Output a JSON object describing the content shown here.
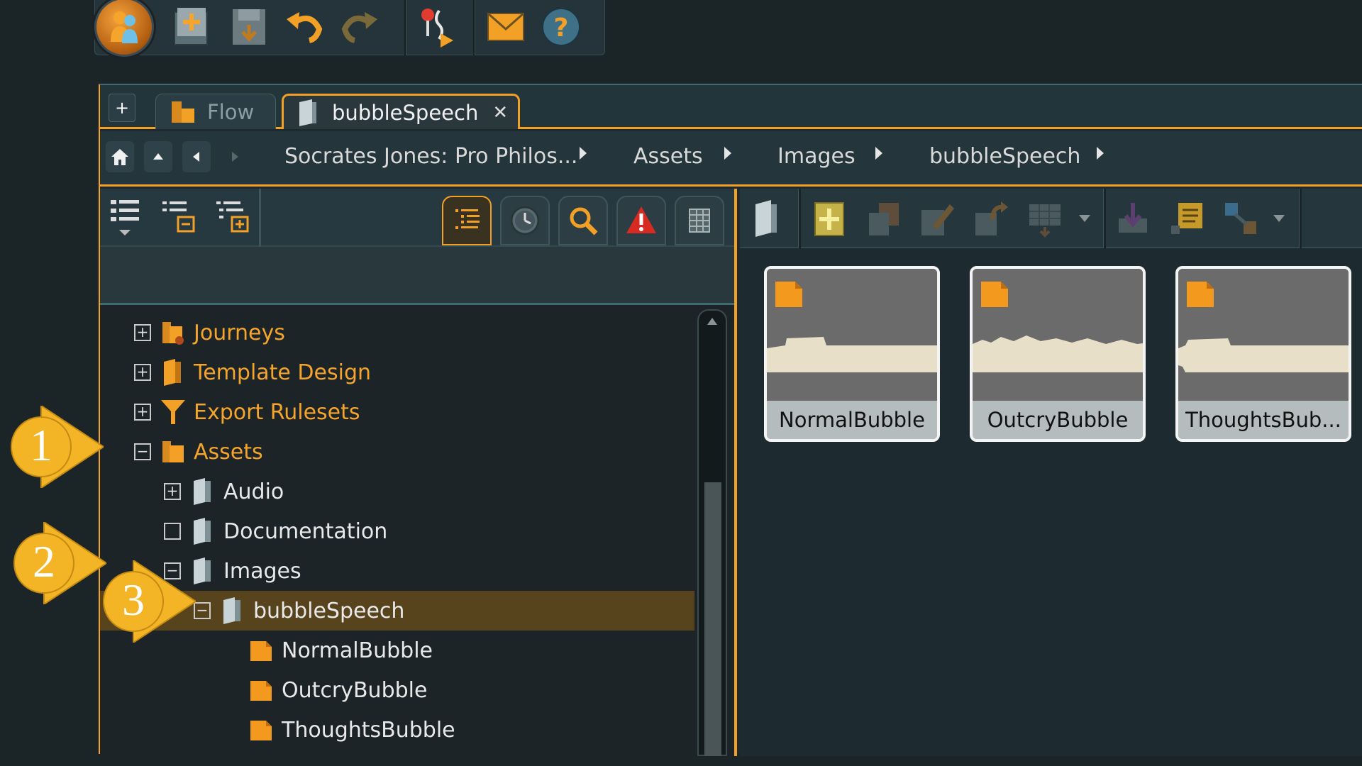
{
  "toolbar": {
    "buttons": [
      {
        "name": "user-icon"
      },
      {
        "name": "new-project-icon"
      },
      {
        "name": "save-icon"
      },
      {
        "name": "undo-icon"
      },
      {
        "name": "redo-icon"
      },
      {
        "name": "debug-run-icon"
      },
      {
        "name": "mail-icon"
      },
      {
        "name": "help-icon"
      }
    ]
  },
  "tabs": {
    "add_label": "+",
    "items": [
      {
        "label": "Flow",
        "active": false
      },
      {
        "label": "bubbleSpeech",
        "active": true,
        "close": "✕"
      }
    ]
  },
  "breadcrumb": {
    "items": [
      "Socrates Jones: Pro Philos...",
      "Assets",
      "Images",
      "bubbleSpeech"
    ]
  },
  "tree": {
    "nodes": [
      {
        "label": "Journeys",
        "expander": "+",
        "color": "orange"
      },
      {
        "label": "Template Design",
        "expander": "+",
        "color": "orange"
      },
      {
        "label": "Export Rulesets",
        "expander": "+",
        "color": "orange"
      },
      {
        "label": "Assets",
        "expander": "−",
        "color": "orange"
      },
      {
        "label": "Audio",
        "expander": "+",
        "color": "white"
      },
      {
        "label": "Documentation",
        "expander": "",
        "color": "white"
      },
      {
        "label": "Images",
        "expander": "−",
        "color": "white"
      },
      {
        "label": "bubbleSpeech",
        "expander": "−",
        "color": "white",
        "selected": true
      },
      {
        "label": "NormalBubble",
        "color": "white"
      },
      {
        "label": "OutcryBubble",
        "color": "white"
      },
      {
        "label": "ThoughtsBubble",
        "color": "white"
      }
    ]
  },
  "thumbnails": [
    {
      "label": "NormalBubble"
    },
    {
      "label": "OutcryBubble"
    },
    {
      "label": "ThoughtsBub..."
    }
  ],
  "callouts": [
    "1",
    "2",
    "3"
  ],
  "colors": {
    "accent": "#f3a126",
    "background": "#1b2427",
    "selected_row": "#57441d"
  }
}
